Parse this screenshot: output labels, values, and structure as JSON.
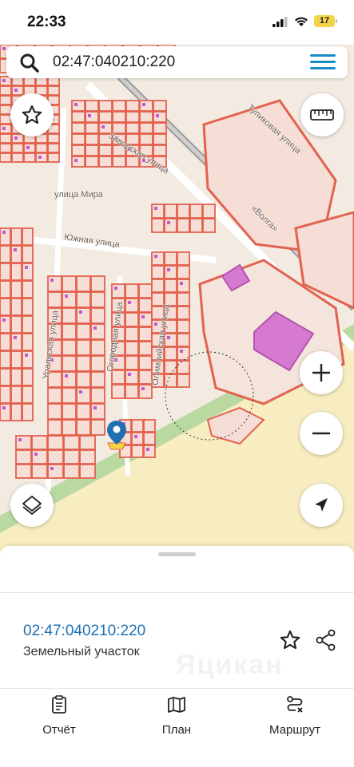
{
  "status_bar": {
    "time": "22:33",
    "battery": "17"
  },
  "search": {
    "value": "02:47:040210:220"
  },
  "map": {
    "street_labels": [
      "Заводская улица",
      "улица Мира",
      "Южная улица",
      "Уральская улица",
      "Огородная улица",
      "Олимпийская улица",
      "Тупиковая улица",
      "«Волга»"
    ],
    "colors": {
      "parcel_stroke": "#e2624f",
      "land": "#f3ebe2",
      "field": "#f7edc0",
      "greenbelt": "#b9d9a0",
      "highlight": "#d67ad1"
    }
  },
  "selected": {
    "cadastral_number": "02:47:040210:220",
    "type": "Земельный участок",
    "watermark": "Яцикан"
  },
  "tabs": [
    {
      "label": "Отчёт",
      "icon": "report-icon"
    },
    {
      "label": "План",
      "icon": "map-plan-icon"
    },
    {
      "label": "Маршрут",
      "icon": "route-icon"
    }
  ]
}
